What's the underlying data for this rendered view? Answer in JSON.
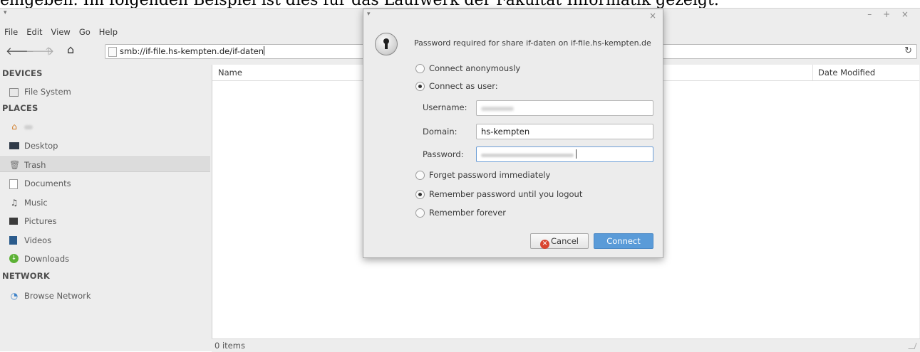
{
  "document": {
    "caption_text": "eingeben. Im folgenden Beispiel ist dies für das Laufwerk der Fakultät Informatik gezeigt."
  },
  "window": {
    "controls": "– + ×"
  },
  "menubar": {
    "items": [
      "File",
      "Edit",
      "View",
      "Go",
      "Help"
    ]
  },
  "toolbar": {
    "back_icon": "back-arrow-icon",
    "forward_icon": "forward-arrow-icon",
    "up_icon": "up-arrow-icon",
    "home_icon": "home-icon",
    "address": "smb://if-file.hs-kempten.de/if-daten",
    "reload_icon": "reload-icon"
  },
  "sidebar": {
    "devices_heading": "DEVICES",
    "devices": [
      {
        "label": "File System",
        "icon": "drive-icon"
      }
    ],
    "places_heading": "PLACES",
    "places": [
      {
        "label": "",
        "icon": "home-icon"
      },
      {
        "label": "Desktop",
        "icon": "desktop-icon"
      },
      {
        "label": "Trash",
        "icon": "trash-icon"
      },
      {
        "label": "Documents",
        "icon": "document-icon"
      },
      {
        "label": "Music",
        "icon": "music-icon"
      },
      {
        "label": "Pictures",
        "icon": "pictures-icon"
      },
      {
        "label": "Videos",
        "icon": "video-icon"
      },
      {
        "label": "Downloads",
        "icon": "download-icon"
      }
    ],
    "network_heading": "NETWORK",
    "network": [
      {
        "label": "Browse Network",
        "icon": "wifi-icon"
      }
    ]
  },
  "main": {
    "columns": [
      "Name",
      "Date Modified"
    ]
  },
  "status": {
    "text": "0 items"
  },
  "dialog": {
    "heading": "Password required for share if-daten on if-file.hs-kempten.de",
    "options": {
      "anonymous": "Connect anonymously",
      "as_user": "Connect as user:"
    },
    "fields": {
      "username_label": "Username:",
      "domain_label": "Domain:",
      "domain_value": "hs-kempten",
      "password_label": "Password:"
    },
    "remember": {
      "forget": "Forget password immediately",
      "until_logout": "Remember password until you logout",
      "forever": "Remember forever"
    },
    "buttons": {
      "cancel": "Cancel",
      "connect": "Connect"
    },
    "close": "×",
    "accent_color": "#5a9bd8"
  }
}
